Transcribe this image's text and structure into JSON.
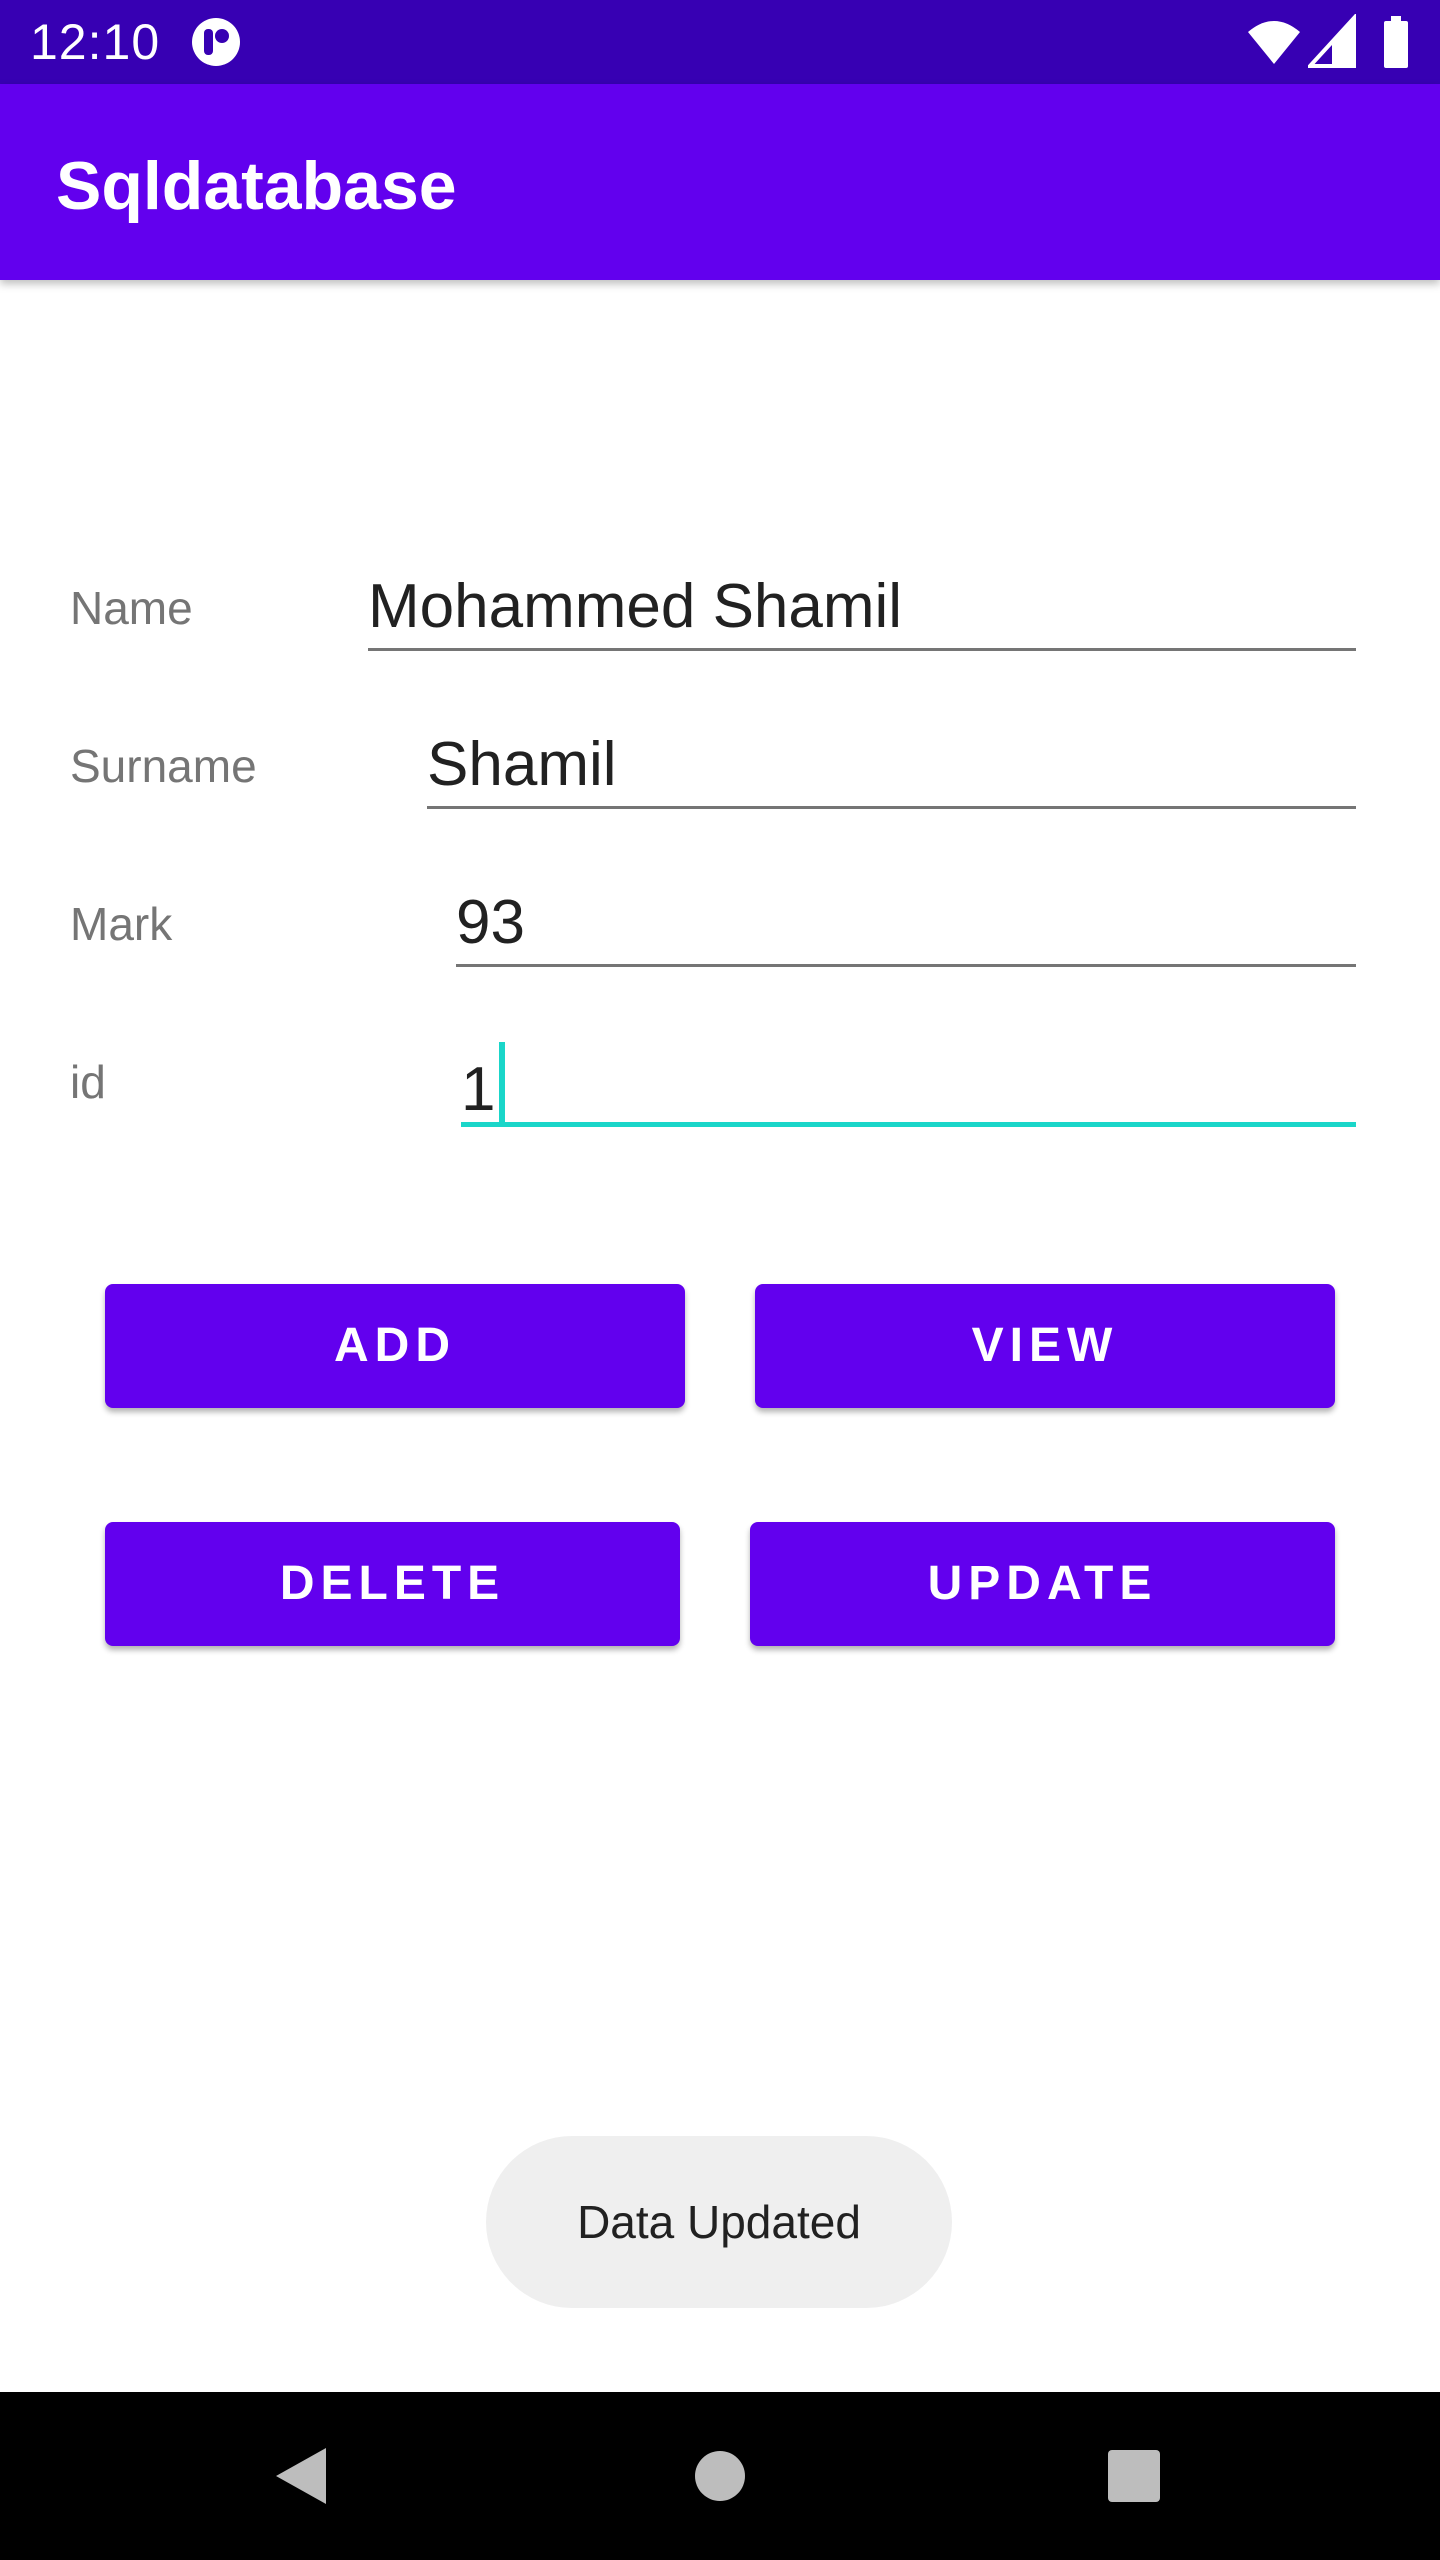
{
  "status_bar": {
    "time": "12:10",
    "icons": [
      "app-notification-icon",
      "wifi-icon",
      "signal-icon",
      "battery-icon"
    ],
    "background": "#3700b3"
  },
  "app_bar": {
    "title": "Sqldatabase",
    "background": "#6200ee"
  },
  "form": {
    "name": {
      "label": "Name",
      "value": "Mohammed Shamil"
    },
    "surname": {
      "label": "Surname",
      "value": "Shamil"
    },
    "mark": {
      "label": "Mark",
      "value": "93"
    },
    "id": {
      "label": "id",
      "value": "1"
    }
  },
  "buttons": {
    "add": "ADD",
    "view": "VIEW",
    "delete": "DELETE",
    "update": "UPDATE",
    "color": "#6200ee"
  },
  "toast": {
    "message": "Data Updated"
  },
  "nav_bar": {
    "icons": [
      "back-icon",
      "home-icon",
      "recents-icon"
    ]
  },
  "colors": {
    "accent": "#1ad6c9",
    "primary": "#6200ee",
    "primary_dark": "#3700b3"
  }
}
